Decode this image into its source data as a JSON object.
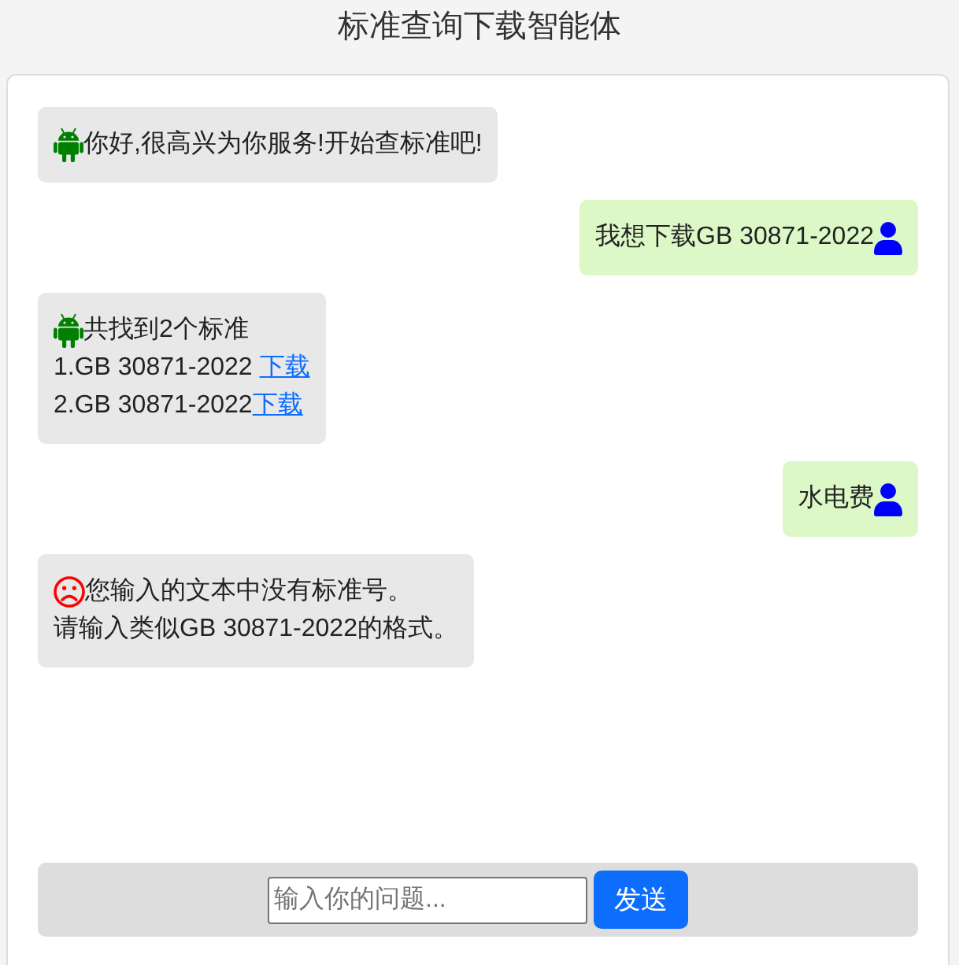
{
  "title": "标准查询下载智能体",
  "messages": [
    {
      "kind": "bot",
      "lines": [
        {
          "text": "你好,很高兴为你服务!开始查标准吧!"
        }
      ]
    },
    {
      "kind": "user",
      "lines": [
        {
          "text": "我想下载GB 30871-2022"
        }
      ]
    },
    {
      "kind": "bot",
      "lines": [
        {
          "text": "共找到2个标准"
        },
        {
          "text": "1.GB 30871-2022 ",
          "link": "下载"
        },
        {
          "text": "2.GB 30871-2022",
          "link": "下载"
        }
      ]
    },
    {
      "kind": "user",
      "lines": [
        {
          "text": "水电费"
        }
      ]
    },
    {
      "kind": "error",
      "lines": [
        {
          "text": "您输入的文本中没有标准号。"
        },
        {
          "text": "请输入类似GB 30871-2022的格式。"
        }
      ]
    }
  ],
  "composer": {
    "placeholder": "输入你的问题...",
    "send_button": "发送"
  }
}
